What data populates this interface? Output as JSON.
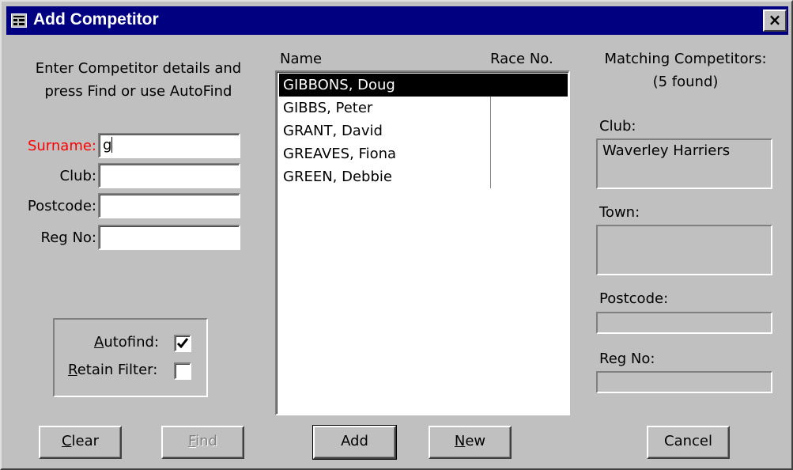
{
  "window": {
    "title": "Add Competitor",
    "close_label": "×"
  },
  "instructions": {
    "line1": "Enter Competitor details and",
    "line2": "press Find or use AutoFind"
  },
  "search_form": {
    "surname_label": "Surname:",
    "surname_value": "g",
    "club_label": "Club:",
    "club_value": "",
    "postcode_label": "Postcode:",
    "postcode_value": "",
    "regno_label": "Reg No:",
    "regno_value": ""
  },
  "options": {
    "autofind_label_u": "A",
    "autofind_label_rest": "utofind:",
    "autofind_checked": true,
    "retain_label_u": "R",
    "retain_label_rest": "etain Filter:",
    "retain_checked": false
  },
  "buttons": {
    "clear_u": "C",
    "clear_rest": "lear",
    "find_u": "F",
    "find_rest": "ind",
    "add": "Add",
    "new_u": "N",
    "new_rest": "ew",
    "cancel": "Cancel"
  },
  "results": {
    "columns": {
      "name": "Name",
      "race_no": "Race No."
    },
    "rows": [
      {
        "name": "GIBBONS, Doug",
        "race_no": "",
        "selected": true
      },
      {
        "name": "GIBBS, Peter",
        "race_no": "",
        "selected": false
      },
      {
        "name": "GRANT, David",
        "race_no": "",
        "selected": false
      },
      {
        "name": "GREAVES, Fiona",
        "race_no": "",
        "selected": false
      },
      {
        "name": "GREEN, Debbie",
        "race_no": "",
        "selected": false
      }
    ]
  },
  "matching": {
    "heading": "Matching Competitors:",
    "count_text": "(5 found)",
    "club_label": "Club:",
    "club_value": "Waverley Harriers",
    "town_label": "Town:",
    "town_value": "",
    "postcode_label": "Postcode:",
    "postcode_value": "",
    "regno_label": "Reg No:",
    "regno_value": ""
  },
  "colors": {
    "titlebar": "#000080",
    "window_bg": "#c0c0c0",
    "required_label": "#ff0000",
    "selection_bg": "#000000"
  }
}
